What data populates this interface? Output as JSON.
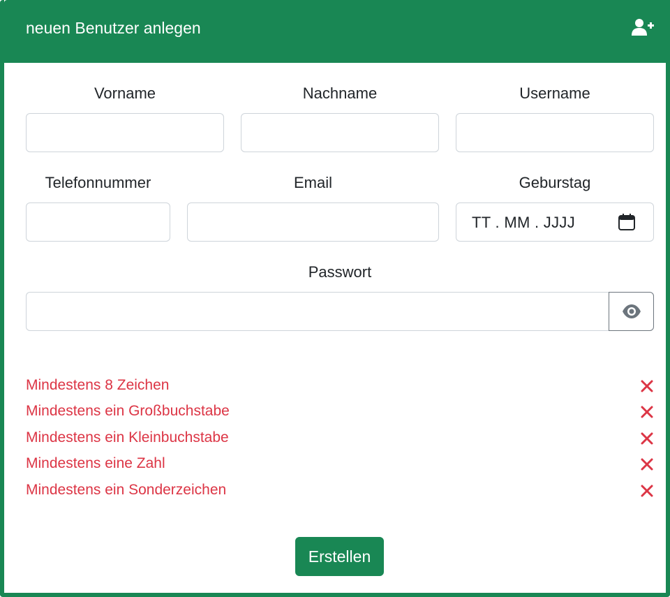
{
  "header": {
    "title": "neuen Benutzer anlegen",
    "icon": "user-plus-icon"
  },
  "form": {
    "vorname": {
      "label": "Vorname",
      "value": ""
    },
    "nachname": {
      "label": "Nachname",
      "value": ""
    },
    "username": {
      "label": "Username",
      "value": ""
    },
    "telefonnummer": {
      "label": "Telefonnummer",
      "value": ""
    },
    "email": {
      "label": "Email",
      "value": ""
    },
    "geburtstag": {
      "label": "Geburstag",
      "placeholder": "TT . MM . JJJJ",
      "icon": "calendar-icon"
    },
    "passwort": {
      "label": "Passwort",
      "value": "",
      "toggle_icon": "eye-icon"
    }
  },
  "password_rules": [
    {
      "text": "Mindestens 8 Zeichen",
      "status": "unmet",
      "icon": "x-icon"
    },
    {
      "text": "Mindestens ein Großbuchstabe",
      "status": "unmet",
      "icon": "x-icon"
    },
    {
      "text": "Mindestens ein Kleinbuchstabe",
      "status": "unmet",
      "icon": "x-icon"
    },
    {
      "text": "Mindestens eine Zahl",
      "status": "unmet",
      "icon": "x-icon"
    },
    {
      "text": "Mindestens ein Sonderzeichen",
      "status": "unmet",
      "icon": "x-icon"
    }
  ],
  "actions": {
    "submit_label": "Erstellen"
  },
  "colors": {
    "primary": "#198754",
    "danger": "#dc3545",
    "border": "#ced4da",
    "secondary": "#6c757d"
  }
}
